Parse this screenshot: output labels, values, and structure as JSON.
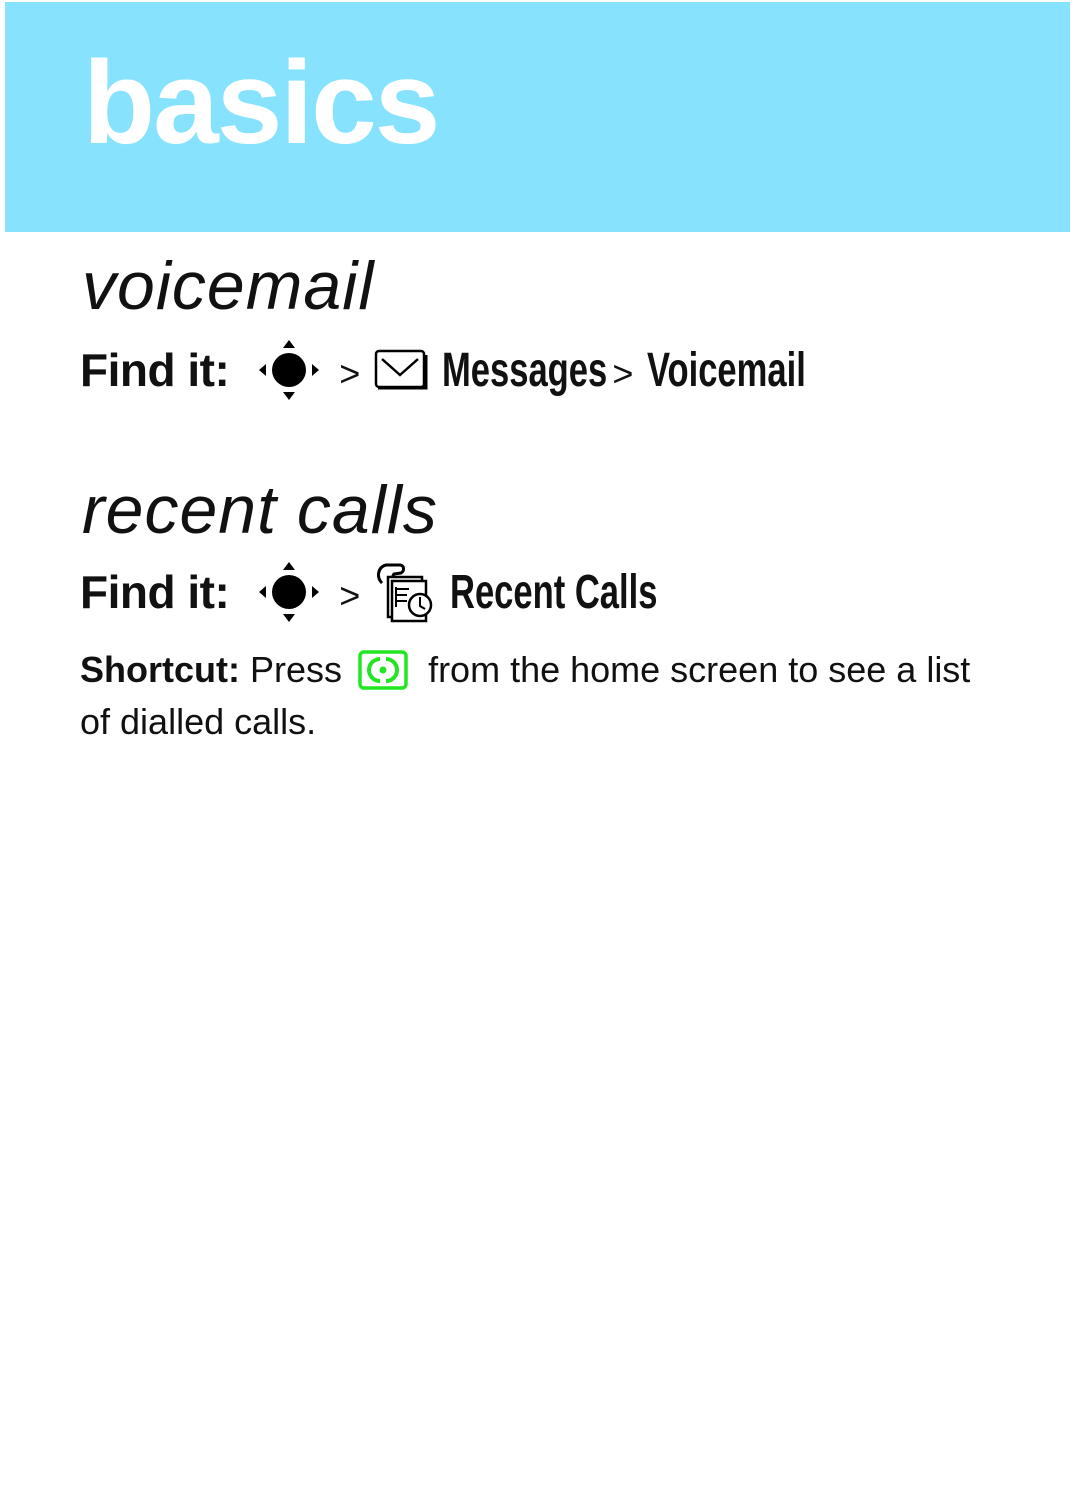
{
  "banner": {
    "title": "basics",
    "color": "#87e2fd"
  },
  "sections": [
    {
      "title": "voicemail",
      "find_it": {
        "label": "Find it:",
        "path": [
          {
            "icon": "nav-key-icon"
          },
          {
            "separator": ">"
          },
          {
            "icon": "envelope-icon",
            "label": "Messages"
          },
          {
            "separator": ">"
          },
          {
            "label": "Voicemail"
          }
        ],
        "sep": ">",
        "messages_label": "Messages",
        "voicemail_label": "Voicemail"
      }
    },
    {
      "title": "recent calls",
      "find_it": {
        "label": "Find it:",
        "sep": ">",
        "recent_calls_label": "Recent Calls"
      },
      "shortcut": {
        "label": "Shortcut:",
        "text_before": "Press",
        "key_icon": "send-key-icon",
        "key_color": "#22e622",
        "text_after": "from the home screen to see a list of dialled calls."
      }
    }
  ]
}
